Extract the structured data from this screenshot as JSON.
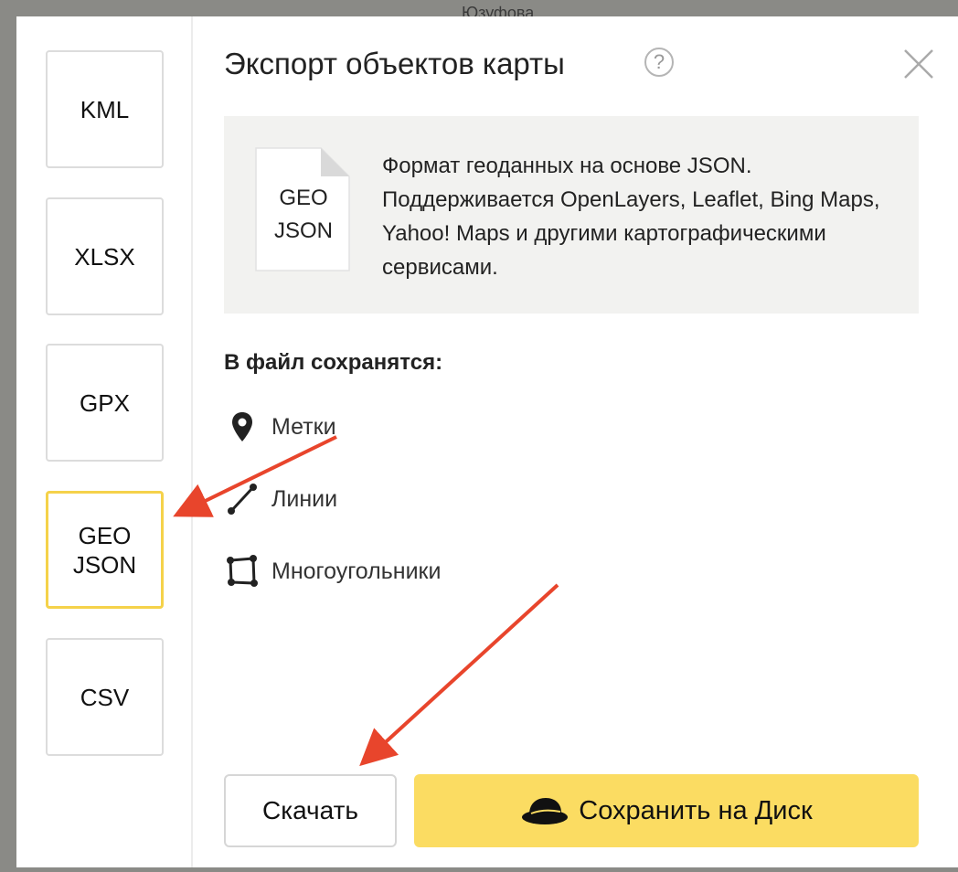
{
  "map": {
    "label_top": "Юзуфова",
    "label_bottom": ""
  },
  "sidebar": {
    "formats": [
      {
        "label": "KML"
      },
      {
        "label": "XLSX"
      },
      {
        "label": "GPX"
      },
      {
        "label": "GEO\nJSON"
      },
      {
        "label": "CSV"
      }
    ],
    "selected": "GEO JSON"
  },
  "dialog": {
    "title": "Экспорт объектов карты",
    "help_symbol": "?",
    "doc_icon_text": "GEO\nJSON",
    "description": "Формат геоданных на основе JSON. Поддерживается OpenLayers, Leaflet, Bing Maps, Yahoo! Maps и другими картографическими сервисами.",
    "saved_heading": "В файл сохранятся:",
    "features": [
      {
        "label": "Метки",
        "icon": "placemark-icon"
      },
      {
        "label": "Линии",
        "icon": "line-icon"
      },
      {
        "label": "Многоугольники",
        "icon": "polygon-icon"
      }
    ],
    "download_label": "Скачать",
    "save_disk_label": "Сохранить на Диск"
  },
  "colors": {
    "accent_yellow": "#fbdc62",
    "selected_border": "#f5d24a",
    "annotation_arrow": "#e8452c"
  }
}
